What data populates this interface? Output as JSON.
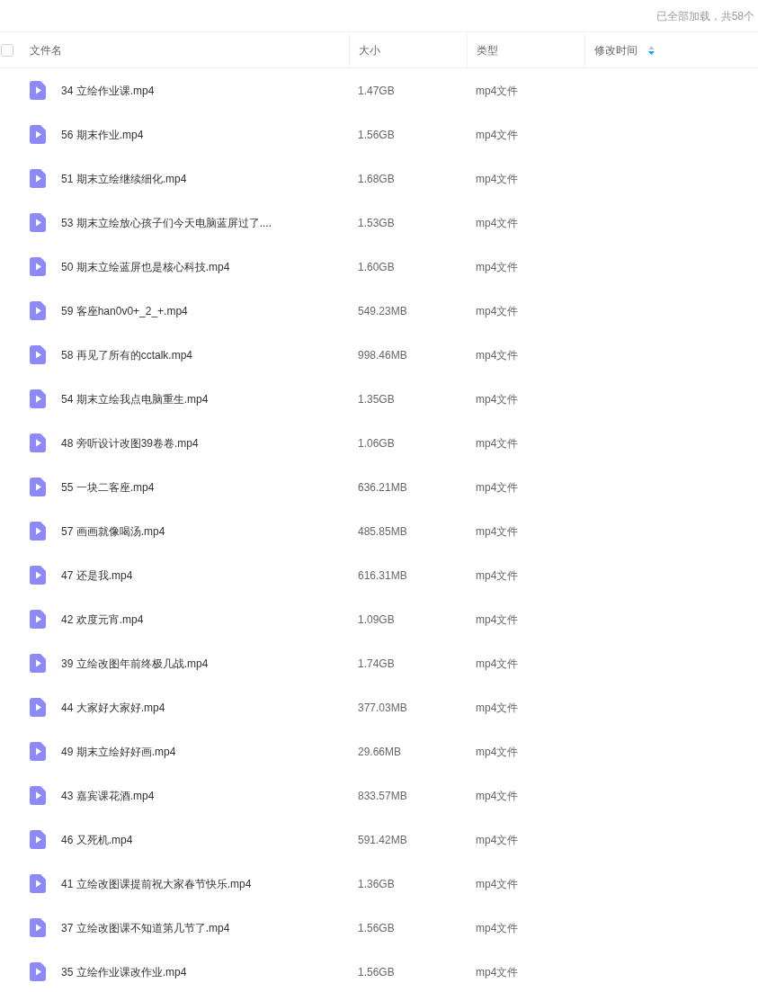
{
  "summary": "已全部加载，共58个",
  "select_all": {
    "checked": false
  },
  "columns": [
    {
      "label": "文件名",
      "sorted": false
    },
    {
      "label": "大小",
      "sorted": false
    },
    {
      "label": "类型",
      "sorted": false
    },
    {
      "label": "修改时间",
      "sorted": true
    }
  ],
  "rows": [
    {
      "name": "34 立绘作业课.mp4",
      "size": "1.47GB",
      "type": "mp4文件"
    },
    {
      "name": "56 期末作业.mp4",
      "size": "1.56GB",
      "type": "mp4文件"
    },
    {
      "name": "51 期末立绘继续细化.mp4",
      "size": "1.68GB",
      "type": "mp4文件"
    },
    {
      "name": "53 期末立绘放心孩子们今天电脑蓝屏过了....",
      "size": "1.53GB",
      "type": "mp4文件"
    },
    {
      "name": "50 期末立绘蓝屏也是核心科技.mp4",
      "size": "1.60GB",
      "type": "mp4文件"
    },
    {
      "name": "59 客座han0v0+_2_+.mp4",
      "size": "549.23MB",
      "type": "mp4文件"
    },
    {
      "name": "58 再见了所有的cctalk.mp4",
      "size": "998.46MB",
      "type": "mp4文件"
    },
    {
      "name": "54 期末立绘我点电脑重生.mp4",
      "size": "1.35GB",
      "type": "mp4文件"
    },
    {
      "name": "48 旁听设计改图39卷卷.mp4",
      "size": "1.06GB",
      "type": "mp4文件"
    },
    {
      "name": "55 一块二客座.mp4",
      "size": "636.21MB",
      "type": "mp4文件"
    },
    {
      "name": "57 画画就像喝汤.mp4",
      "size": "485.85MB",
      "type": "mp4文件"
    },
    {
      "name": "47 还是我.mp4",
      "size": "616.31MB",
      "type": "mp4文件"
    },
    {
      "name": "42 欢度元宵.mp4",
      "size": "1.09GB",
      "type": "mp4文件"
    },
    {
      "name": "39 立绘改图年前终极几战.mp4",
      "size": "1.74GB",
      "type": "mp4文件"
    },
    {
      "name": "44 大家好大家好.mp4",
      "size": "377.03MB",
      "type": "mp4文件"
    },
    {
      "name": "49 期末立绘好好画.mp4",
      "size": "29.66MB",
      "type": "mp4文件"
    },
    {
      "name": "43 嘉宾课花酒.mp4",
      "size": "833.57MB",
      "type": "mp4文件"
    },
    {
      "name": "46 又死机.mp4",
      "size": "591.42MB",
      "type": "mp4文件"
    },
    {
      "name": "41 立绘改图课提前祝大家春节快乐.mp4",
      "size": "1.36GB",
      "type": "mp4文件"
    },
    {
      "name": "37 立绘改图课不知道第几节了.mp4",
      "size": "1.56GB",
      "type": "mp4文件"
    },
    {
      "name": "35 立绘作业课改作业.mp4",
      "size": "1.56GB",
      "type": "mp4文件"
    }
  ]
}
